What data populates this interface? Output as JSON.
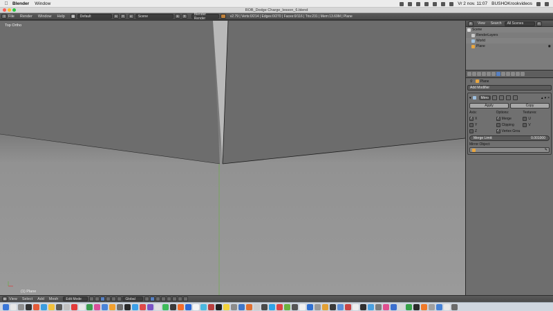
{
  "mac_menubar": {
    "app_name": "Blender",
    "menu_items": [
      "Window"
    ],
    "clock": "Vr 2 nov.  11:07",
    "user": "BUSHOKrookvideos"
  },
  "window": {
    "title": "ROB_Dodge Charge_lesson_6.blend"
  },
  "info_header": {
    "menus": [
      "File",
      "Render",
      "Window",
      "Help"
    ],
    "layout": "Default",
    "scene": "Scene",
    "engine": "Blender Render",
    "stats": "v2.79 | Verts:0/214 | Edges:0/270 | Faces:0/116 | Tris:231 | Mem:13.69M | Plane"
  },
  "viewport": {
    "view_label": "Top Ortho",
    "object_label": "(1) Plane"
  },
  "outliner": {
    "view_label": "View",
    "search_label": "Search",
    "filter": "All Scenes",
    "rows": [
      {
        "label": "Scene",
        "icon_color": "#d8d8d8"
      },
      {
        "label": "RenderLayers",
        "icon_color": "#c9c9c9"
      },
      {
        "label": "World",
        "icon_color": "#9ec0e0"
      },
      {
        "label": "Plane",
        "icon_color": "#e8a640"
      }
    ]
  },
  "properties": {
    "context_object": "Plane",
    "add_modifier": "Add Modifier",
    "modifier_name": "Mirro",
    "apply": "Apply",
    "copy": "Copy",
    "axis_header": "Axis:",
    "options_header": "Options:",
    "textures_header": "Textures:",
    "axis": [
      {
        "label": "X",
        "checked": true
      },
      {
        "label": "Y",
        "checked": false
      },
      {
        "label": "Z",
        "checked": false
      }
    ],
    "options": [
      {
        "label": "Merge",
        "checked": true
      },
      {
        "label": "Clipping",
        "checked": false
      },
      {
        "label": "Vertex Grou",
        "checked": true
      }
    ],
    "textures": [
      {
        "label": "U",
        "checked": false
      },
      {
        "label": "V",
        "checked": false
      }
    ],
    "merge_limit_label": "Merge Limit:",
    "merge_limit_value": "0.001000",
    "mirror_object_label": "Mirror Object:",
    "mirror_object_value": ""
  },
  "viewport_header": {
    "menus": [
      "View",
      "Select",
      "Add",
      "Mesh"
    ],
    "mode": "Edit Mode",
    "orientation": "Global"
  },
  "colors": {
    "accent": "#5680c2",
    "viewport_bg": "#7a7a7a",
    "mesh_face": "#6c6c6c",
    "y_axis": "#6dad4b"
  },
  "dock_icons": [
    "#3a77d8",
    "#e8e8e8",
    "#8f8f8f",
    "#333333",
    "#e45c3a",
    "#3b9de0",
    "#f2c23e",
    "#5a5a5a",
    "#c0c0c0",
    "#e23b3b",
    "#e9e9e9",
    "#3b9d4f",
    "#d94f9b",
    "#4a84d9",
    "#f0a030",
    "#6f6f6f",
    "#2a2a2a",
    "#3ca0e8",
    "#df4a4a",
    "#7a54c4",
    "#e0e0e0",
    "#3dbb5a",
    "#3a3a3a",
    "#f36c2a",
    "#2c6ad6",
    "#f5f5f5",
    "#4bb8e0",
    "#b83e3e",
    "#1f1f1f",
    "#f2d23c",
    "#8c8c8c",
    "#3f76c8",
    "#e07030",
    "#cccccc",
    "#4a4a4a",
    "#2fa3e6",
    "#dd4444",
    "#6db33f",
    "#555555",
    "#f0f0f0",
    "#3070d0",
    "#9a9a9a",
    "#e3a135",
    "#3a3a3a",
    "#5b8fd9",
    "#c94545",
    "#efefef",
    "#2f2f2f",
    "#4aa0e0",
    "#7d7d7d",
    "#e04f8f",
    "#3b6fcf",
    "#d9d9d9",
    "#37a24a",
    "#2b2b2b",
    "#f07a2a",
    "#a0a0a0",
    "#4682d6",
    "#e8e8e8",
    "#6a6a6a"
  ]
}
